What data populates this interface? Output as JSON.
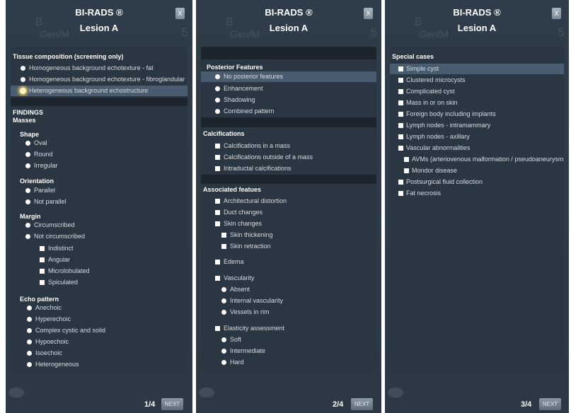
{
  "header": {
    "title": "BI-RADS ®",
    "subtitle": "Lesion A",
    "close_label": "X",
    "next_label": "NEXT"
  },
  "background_text": {
    "b": "B",
    "gen": "Gen/M",
    "num": "5"
  },
  "pages": [
    {
      "pager": "1/4",
      "sections": {
        "tissue": "Tissue composition (screening only)",
        "findings": "FINDINGS",
        "masses": "Masses",
        "shape": "Shape",
        "orientation": "Orientation",
        "margin": "Margin",
        "echo": "Echo pattern"
      },
      "tissue_options": [
        "Homogeneous background echotexture - fat",
        "Homogeneous background echotexture - fibroglandular",
        "Heterogeneous background echostructure"
      ],
      "shape_options": [
        "Oval",
        "Round",
        "Irregular"
      ],
      "orientation_options": [
        "Parallel",
        "Not parallel"
      ],
      "margin_options": [
        "Circumscribed",
        "Not circumscribed"
      ],
      "margin_sub_options": [
        "Indistinct",
        "Angular",
        "Microlobulated",
        "Spiculated"
      ],
      "echo_options": [
        "Anechoic",
        "Hyperechoic",
        "Complex cystic and solid",
        "Hypoechoic",
        "Isoechoic",
        "Heterogeneous"
      ]
    },
    {
      "pager": "2/4",
      "sections": {
        "posterior": "Posterior Features",
        "calc": "Calcifications",
        "assoc": "Associated featues"
      },
      "posterior_options": [
        "No posterior features",
        "Enhancement",
        "Shadowing",
        "Combined pattern"
      ],
      "calc_options": [
        "Calcifications in a mass",
        "Calcifications outside of a mass",
        "Intraductal calcifications"
      ],
      "assoc_options": [
        "Architectural distortion",
        "Duct changes",
        "Skin changes"
      ],
      "skin_sub": [
        "Skin thickening",
        "Skin retraction"
      ],
      "edema": "Edema",
      "vascularity": "Vascularity",
      "vascularity_sub": [
        "Absent",
        "Internal vascularity",
        "Vessels in rim"
      ],
      "elasticity": "Elasticity assessment",
      "elasticity_sub": [
        "Soft",
        "Intermediate",
        "Hard"
      ]
    },
    {
      "pager": "3/4",
      "sections": {
        "special": "Special cases"
      },
      "special_options": [
        "Simple cyst",
        "Clustered microcysts",
        "Complicated cyst",
        "Mass in or on skin",
        "Foreign body including implants",
        "Lymph nodes - intramammary",
        "Lymph nodes - axillary",
        "Vascular abnormalities"
      ],
      "vascular_sub": [
        "AVMs (arteriovenous malformation / pseudoaneurysms)",
        "Mondor disease"
      ],
      "special_tail": [
        "Postsurgical fluid collection",
        "Fat necrosis"
      ]
    }
  ],
  "colors": {
    "panel": "#2f3c49",
    "content": "#2a3642",
    "band": "#1c252e",
    "highlight": "#4a5c70",
    "selected_glow": "#f4c64a"
  }
}
